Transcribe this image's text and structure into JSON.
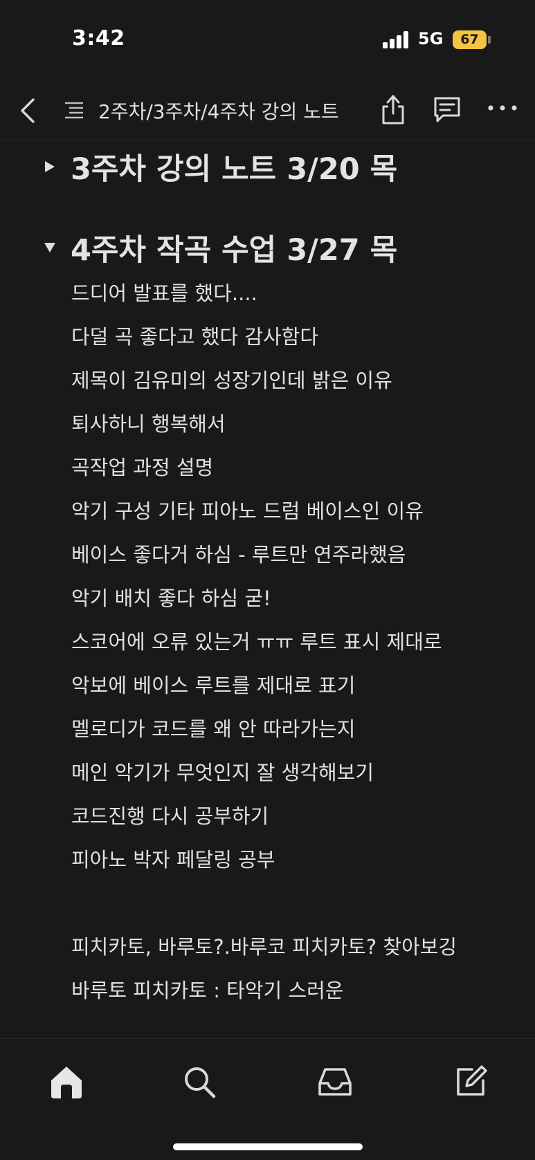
{
  "status_bar": {
    "time": "3:42",
    "network": "5G",
    "battery": "67"
  },
  "top_nav": {
    "title": "2주차/3주차/4주차 강의 노트",
    "icons": [
      "chevron-left-icon",
      "list-icon",
      "share-icon",
      "comment-icon",
      "more-icon"
    ]
  },
  "content": {
    "toggles": [
      {
        "title": "3주차 강의 노트 3/20 목",
        "expanded": false
      },
      {
        "title": "4주차 작곡 수업 3/27 목",
        "expanded": true
      }
    ],
    "lines": [
      "드디어 발표를 했다....",
      "다덜 곡 좋다고 했다 감사함다",
      "제목이 김유미의 성장기인데 밝은 이유",
      "퇴사하니 행복해서",
      "곡작업 과정 설명",
      "악기 구성 기타 피아노 드럼 베이스인 이유",
      "베이스 좋다거 하심 - 루트만 연주라했음",
      "악기 배치 좋다 하심 굳!",
      "스코어에 오류 있는거 ㅠㅠ 루트 표시 제대로",
      "악보에 베이스 루트를 제대로 표기",
      "멜로디가 코드를 왜 안 따라가는지",
      "메인 악기가 무엇인지 잘 생각해보기",
      "코드진행 다시 공부하기",
      "피아노 박자 페달링 공부",
      "",
      "피치카토, 바루토?.바루코 피치카토? 찾아보깅",
      "바루토 피치카토 :  타악기 스러운"
    ]
  },
  "tab_bar": {
    "tabs": [
      "home-icon",
      "search-icon",
      "inbox-icon",
      "compose-icon"
    ]
  },
  "colors": {
    "background": "#191919",
    "text": "#e1e1e1",
    "battery": "#f4c542"
  }
}
